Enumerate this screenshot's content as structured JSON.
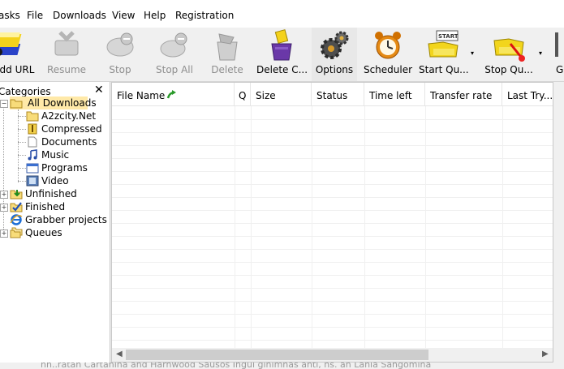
{
  "menu": [
    "asks",
    "File",
    "Downloads",
    "View",
    "Help",
    "Registration"
  ],
  "toolbar": {
    "add_url": "Add URL",
    "resume": "Resume",
    "stop": "Stop",
    "stop_all": "Stop All",
    "delete": "Delete",
    "delete_completed": "Delete C...",
    "options": "Options",
    "scheduler": "Scheduler",
    "start_queue": "Start Qu...",
    "start_sign": "START",
    "stop_queue": "Stop Qu...",
    "grabber": "G",
    "drop_arrow": "▾"
  },
  "categories": {
    "title": "Categories",
    "close": "✕",
    "items": {
      "all_downloads": "All Downloads",
      "a2zcity": "A2zcity.Net",
      "compressed": "Compressed",
      "documents": "Documents",
      "music": "Music",
      "programs": "Programs",
      "video": "Video",
      "unfinished": "Unfinished",
      "finished": "Finished",
      "grabber_projects": "Grabber projects",
      "queues": "Queues"
    },
    "expander_minus": "−",
    "expander_plus": "+"
  },
  "table": {
    "columns": [
      "File Name",
      "Q",
      "Size",
      "Status",
      "Time left",
      "Transfer rate",
      "Last Try..."
    ]
  },
  "scroll": {
    "left": "◀",
    "right": "▶"
  },
  "status_text": "nn..ratan Cartanina and Harnwood Sausos Ingui ginimnas anti, ns. an Lania Sangomina"
}
